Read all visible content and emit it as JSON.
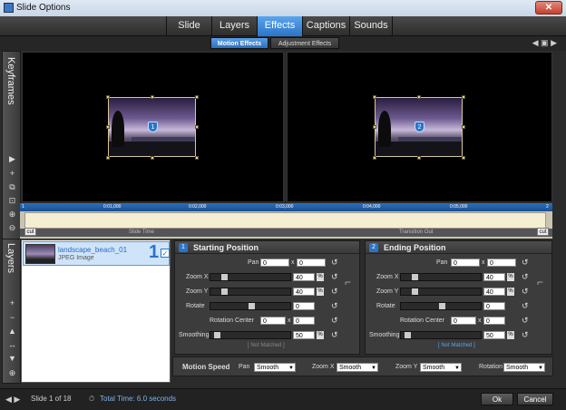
{
  "window": {
    "title": "Slide Options",
    "close_label": "✕"
  },
  "tabs": [
    {
      "label": "Slide"
    },
    {
      "label": "Layers"
    },
    {
      "label": "Effects"
    },
    {
      "label": "Captions"
    },
    {
      "label": "Sounds"
    }
  ],
  "subtabs": [
    {
      "label": "Motion Effects"
    },
    {
      "label": "Adjustment Effects"
    }
  ],
  "sidebar": {
    "keyframes_label": "Keyframes",
    "layers_label": "Layers"
  },
  "previews": {
    "start_badge": "1",
    "end_badge": "2"
  },
  "timeline": {
    "ticks": [
      "0:01,000",
      "0:02,000",
      "0:03,000",
      "0:04,000",
      "0:05,000"
    ],
    "start_marker": "1",
    "end_marker": "2",
    "slide_time_label": "Slide Time",
    "transition_out_label": "Transition Out",
    "cut_label": "cut"
  },
  "layer": {
    "name": "landscape_beach_01",
    "type": "JPEG Image",
    "number": "1",
    "checked": "✓"
  },
  "starting": {
    "number": "1",
    "title": "Starting Position",
    "pan_label": "Pan",
    "pan_x": "0",
    "pan_y": "0",
    "zoomx_label": "Zoom X",
    "zoomx": "40",
    "zoomy_label": "Zoom Y",
    "zoomy": "40",
    "rotate_label": "Rotate",
    "rotate": "0",
    "rc_label": "Rotation Center",
    "rc_x": "0",
    "rc_y": "0",
    "smoothing_label": "Smoothing",
    "smoothing": "50",
    "not_matched": "[ Not Matched ]",
    "x_sep": "x",
    "pct": "%"
  },
  "ending": {
    "number": "2",
    "title": "Ending Position",
    "pan_label": "Pan",
    "pan_x": "0",
    "pan_y": "0",
    "zoomx_label": "Zoom X",
    "zoomx": "40",
    "zoomy_label": "Zoom Y",
    "zoomy": "40",
    "rotate_label": "Rotate",
    "rotate": "0",
    "rc_label": "Rotation Center",
    "rc_x": "0",
    "rc_y": "0",
    "smoothing_label": "Smoothing",
    "smoothing": "50",
    "not_matched": "[ Not Matched ]",
    "x_sep": "x",
    "pct": "%"
  },
  "motion_speed": {
    "label": "Motion Speed",
    "pan_label": "Pan",
    "pan": "Smooth",
    "zoomx_label": "Zoom X",
    "zoomx": "Smooth",
    "zoomy_label": "Zoom Y",
    "zoomy": "Smooth",
    "rotation_label": "Rotation",
    "rotation": "Smooth"
  },
  "footer": {
    "slide_info": "Slide 1 of 18",
    "total_time": "Total Time: 6.0 seconds",
    "ok": "Ok",
    "cancel": "Cancel"
  },
  "colors": {
    "accent": "#2b74c8",
    "link": "#5aa5ee"
  }
}
